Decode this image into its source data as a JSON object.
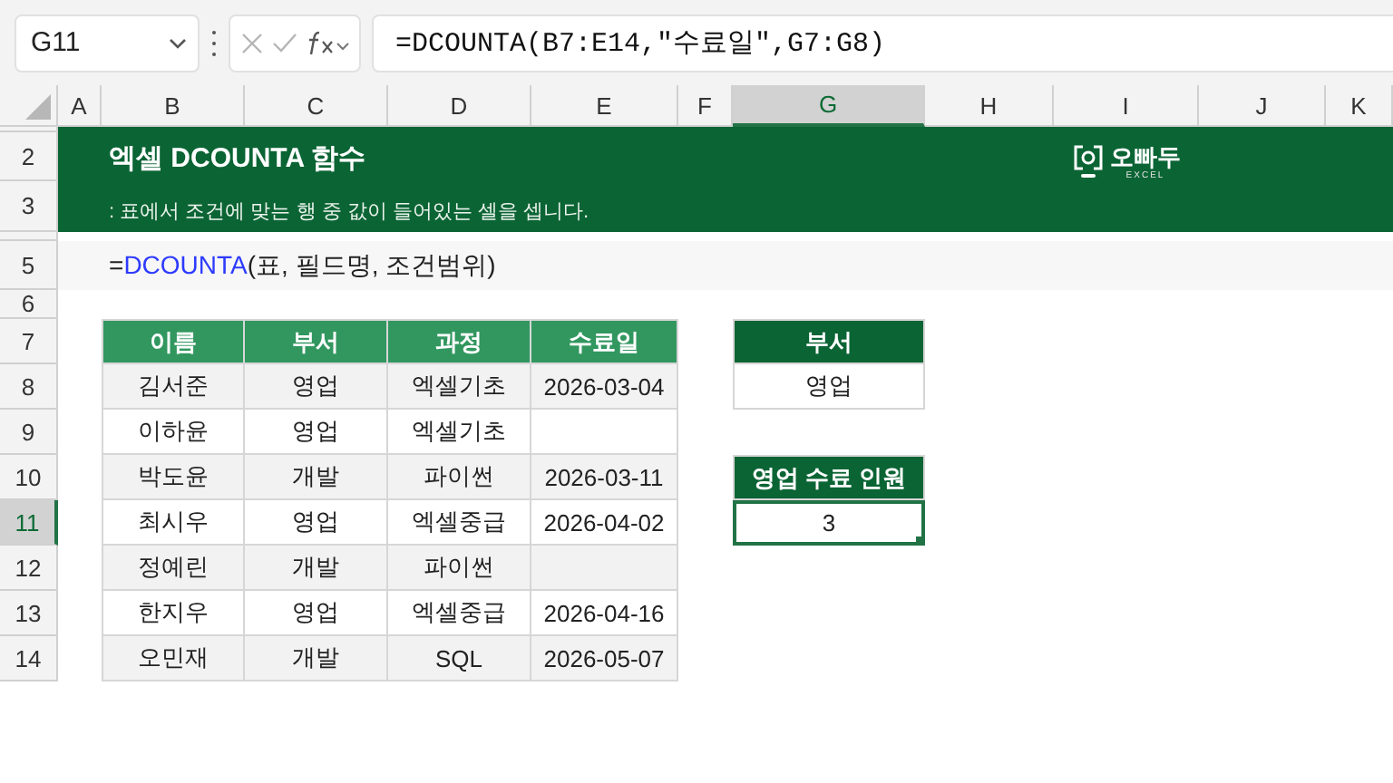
{
  "name_box": "G11",
  "formula": "=DCOUNTA(B7:E14,\"수료일\",G7:G8)",
  "columns": [
    {
      "label": "A",
      "selected": false
    },
    {
      "label": "B",
      "selected": false
    },
    {
      "label": "C",
      "selected": false
    },
    {
      "label": "D",
      "selected": false
    },
    {
      "label": "E",
      "selected": false
    },
    {
      "label": "F",
      "selected": false
    },
    {
      "label": "G",
      "selected": true
    },
    {
      "label": "H",
      "selected": false
    },
    {
      "label": "I",
      "selected": false
    },
    {
      "label": "J",
      "selected": false
    },
    {
      "label": "K",
      "selected": false
    }
  ],
  "rows": [
    {
      "selected": false
    },
    {
      "label": "2",
      "selected": false
    },
    {
      "label": "3",
      "selected": false
    },
    {
      "selected": false
    },
    {
      "label": "5",
      "selected": false
    },
    {
      "label": "6",
      "selected": false
    },
    {
      "label": "7",
      "selected": false
    },
    {
      "label": "8",
      "selected": false
    },
    {
      "label": "9",
      "selected": false
    },
    {
      "label": "10",
      "selected": false
    },
    {
      "label": "11",
      "selected": true
    },
    {
      "label": "12",
      "selected": false
    },
    {
      "label": "13",
      "selected": false
    },
    {
      "label": "14",
      "selected": false
    }
  ],
  "banner": {
    "title": "엑셀 DCOUNTA 함수",
    "subtitle": ": 표에서 조건에 맞는 행 중 값이 들어있는 셀을 셉니다.",
    "logo": "오빠두",
    "logo_sub": "EXCEL"
  },
  "syntax": {
    "prefix": "=",
    "function": "DCOUNTA",
    "args": "(표, 필드명, 조건범위)"
  },
  "table": {
    "columns": [
      "이름",
      "부서",
      "과정",
      "수료일"
    ],
    "rows": [
      [
        "김서준",
        "영업",
        "엑셀기초",
        "2026-03-04"
      ],
      [
        "이하윤",
        "영업",
        "엑셀기초",
        ""
      ],
      [
        "박도윤",
        "개발",
        "파이썬",
        "2026-03-11"
      ],
      [
        "최시우",
        "영업",
        "엑셀중급",
        "2026-04-02"
      ],
      [
        "정예린",
        "개발",
        "파이썬",
        ""
      ],
      [
        "한지우",
        "영업",
        "엑셀중급",
        "2026-04-16"
      ],
      [
        "오민재",
        "개발",
        "SQL",
        "2026-05-07"
      ]
    ]
  },
  "criteria": {
    "header": "부서",
    "value": "영업"
  },
  "result": {
    "header": "영업 수료 인원",
    "value": "3",
    "selected": true
  }
}
